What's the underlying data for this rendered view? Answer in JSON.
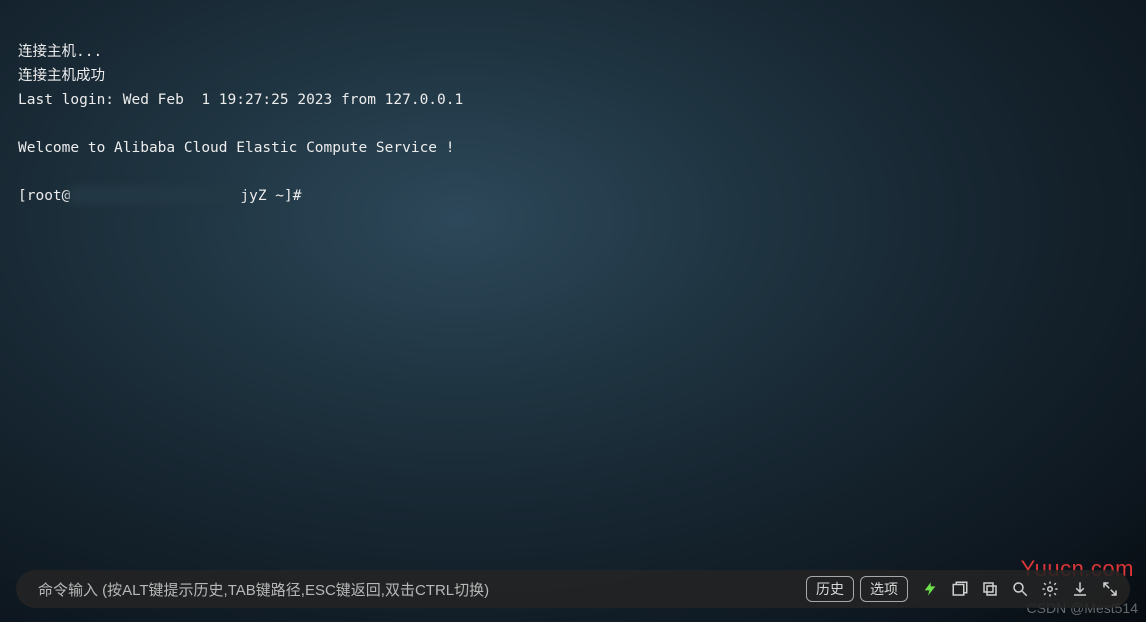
{
  "terminal": {
    "line1": "连接主机...",
    "line2": "连接主机成功",
    "line3": "Last login: Wed Feb  1 19:27:25 2023 from 127.0.0.1",
    "welcome": "Welcome to Alibaba Cloud Elastic Compute Service !",
    "prompt_prefix": "[root@",
    "prompt_suffix": "jyZ ~]#"
  },
  "bottom": {
    "placeholder": "命令输入 (按ALT键提示历史,TAB键路径,ESC键返回,双击CTRL切换)",
    "history_btn": "历史",
    "options_btn": "选项"
  },
  "watermarks": {
    "site": "Yuucn.com",
    "csdn": "CSDN @Mest514"
  },
  "icons": [
    "bolt-icon",
    "windows-icon",
    "copy-icon",
    "search-icon",
    "settings-icon",
    "download-icon",
    "expand-icon"
  ]
}
